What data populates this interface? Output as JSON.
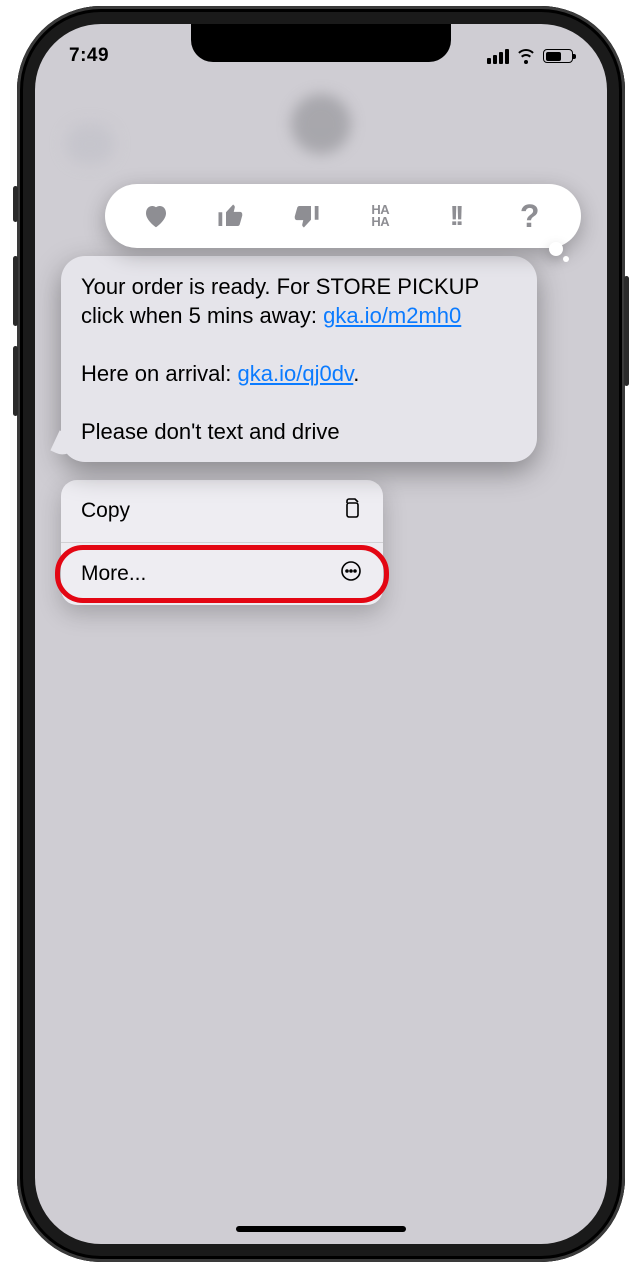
{
  "status": {
    "time": "7:49"
  },
  "tapbacks": [
    "heart",
    "thumbs-up",
    "thumbs-down",
    "haha",
    "exclaim",
    "question"
  ],
  "message": {
    "line1a": "Your order is ready. For STORE PICKUP click when 5 mins away: ",
    "link1": "gka.io/m2mh0",
    "line2a": "Here on arrival: ",
    "link2": "gka.io/qj0dv",
    "line2b": ".",
    "line3": "Please don't text and drive"
  },
  "menu": {
    "copy": "Copy",
    "more": "More..."
  }
}
